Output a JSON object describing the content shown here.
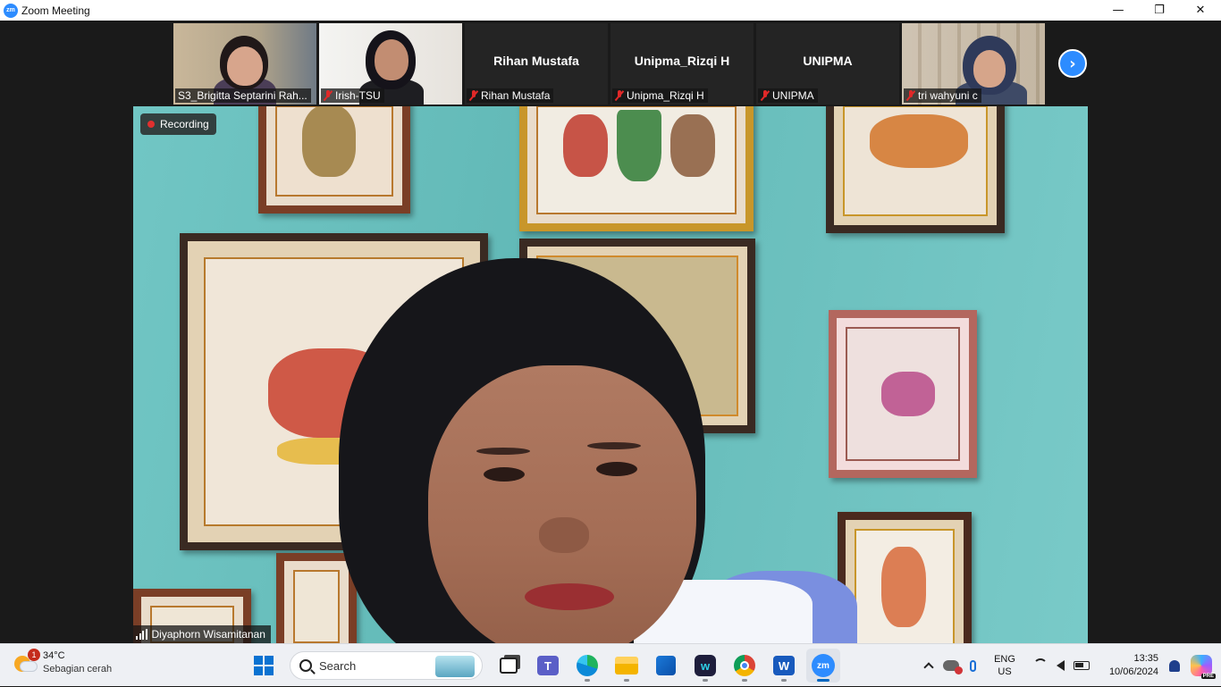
{
  "window": {
    "app_icon": "zm",
    "title": "Zoom Meeting",
    "minimize_glyph": "—",
    "maximize_glyph": "❐",
    "close_glyph": "✕"
  },
  "meeting": {
    "gallery": [
      {
        "label": "S3_Brigitta Septarini Rah...",
        "has_video": true,
        "muted": false
      },
      {
        "label": "Irish-TSU",
        "has_video": true,
        "muted": true
      },
      {
        "label": "Rihan Mustafa",
        "center_name": "Rihan Mustafa",
        "has_video": false,
        "muted": true
      },
      {
        "label": "Unipma_Rizqi H",
        "center_name": "Unipma_Rizqi H",
        "has_video": false,
        "muted": true
      },
      {
        "label": "UNIPMA",
        "center_name": "UNIPMA",
        "has_video": false,
        "muted": true
      },
      {
        "label": "tri wahyuni c",
        "has_video": true,
        "muted": true
      }
    ],
    "next_page_glyph": "›",
    "recording_label": "Recording",
    "active_speaker": "Diyaphorn Wisamitanan"
  },
  "taskbar": {
    "weather": {
      "temp": "34°C",
      "condition": "Sebagian cerah",
      "badge": "1"
    },
    "search_placeholder": "Search",
    "lang_top": "ENG",
    "lang_bottom": "US",
    "time": "13:35",
    "date": "10/06/2024",
    "zoom_icon": "zm",
    "word_icon": "W",
    "copilot_badge": "PRE"
  },
  "colors": {
    "zoom_blue": "#2d8cff",
    "recording_red": "#e0302f",
    "muted_red": "#e02828",
    "taskbar_bg": "#eef0f4"
  }
}
